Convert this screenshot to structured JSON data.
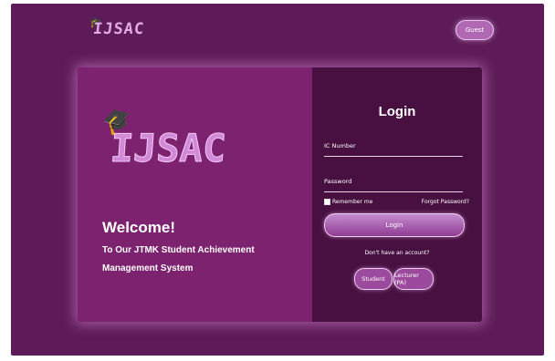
{
  "header": {
    "logo_text": "IJSAC",
    "guest_label": "Guest"
  },
  "hero": {
    "logo_text": "IJSAC",
    "welcome_title": "Welcome!",
    "welcome_subtitle": "To Our JTMK Student Achievement Management System"
  },
  "login": {
    "title": "Login",
    "ic_label": "IC Number",
    "password_label": "Password",
    "remember_label": "Remember me",
    "forgot_label": "Forgot Password?",
    "submit_label": "Login",
    "no_account_text": "Don't have an account?",
    "student_label": "Student",
    "lecturer_label": "Lecturer (PA)"
  },
  "colors": {
    "background": "#5d1c57",
    "card_left": "#7d226f",
    "card_right": "#471040",
    "accent": "#b068b3"
  },
  "icons": {
    "logo": "graduation-cap-icon"
  }
}
